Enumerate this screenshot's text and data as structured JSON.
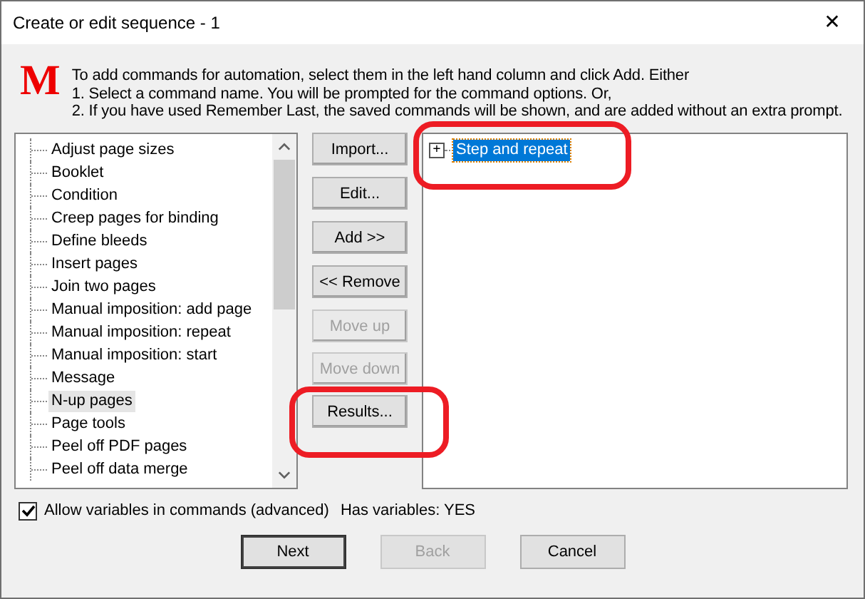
{
  "window": {
    "title": "Create or edit sequence - 1",
    "close": "✕"
  },
  "header": {
    "logo": "M",
    "lines": [
      "To add commands for automation, select them in the left hand column and click Add. Either",
      "1. Select a command name. You will be prompted for the command options. Or,",
      "2. If you have used Remember Last, the saved commands will be shown, and are added without an extra prompt."
    ]
  },
  "commands": [
    {
      "label": "Adjust page sizes",
      "selected": false
    },
    {
      "label": "Booklet",
      "selected": false
    },
    {
      "label": "Condition",
      "selected": false
    },
    {
      "label": "Creep pages for binding",
      "selected": false
    },
    {
      "label": "Define bleeds",
      "selected": false
    },
    {
      "label": "Insert pages",
      "selected": false
    },
    {
      "label": "Join two pages",
      "selected": false
    },
    {
      "label": "Manual imposition: add page",
      "selected": false
    },
    {
      "label": "Manual imposition: repeat",
      "selected": false
    },
    {
      "label": "Manual imposition: start",
      "selected": false
    },
    {
      "label": "Message",
      "selected": false
    },
    {
      "label": "N-up pages",
      "selected": true
    },
    {
      "label": "Page tools",
      "selected": false
    },
    {
      "label": "Peel off PDF pages",
      "selected": false
    },
    {
      "label": "Peel off data merge",
      "selected": false
    }
  ],
  "actions": [
    {
      "label": "Import...",
      "disabled": false
    },
    {
      "label": "Edit...",
      "disabled": false
    },
    {
      "label": "Add >>",
      "disabled": false
    },
    {
      "label": "<< Remove",
      "disabled": false
    },
    {
      "label": "Move up",
      "disabled": true
    },
    {
      "label": "Move down",
      "disabled": true
    },
    {
      "label": "Results...",
      "disabled": false
    }
  ],
  "sequence": [
    {
      "label": "Step and repeat",
      "selected": true,
      "expanded": false,
      "expander": "+"
    }
  ],
  "allow_variables": {
    "label": "Allow variables in commands (advanced)",
    "checked": true
  },
  "has_variables": "Has variables: YES",
  "buttons": [
    {
      "label": "Next",
      "disabled": false
    },
    {
      "label": "Back",
      "disabled": true
    },
    {
      "label": "Cancel",
      "disabled": false
    }
  ]
}
